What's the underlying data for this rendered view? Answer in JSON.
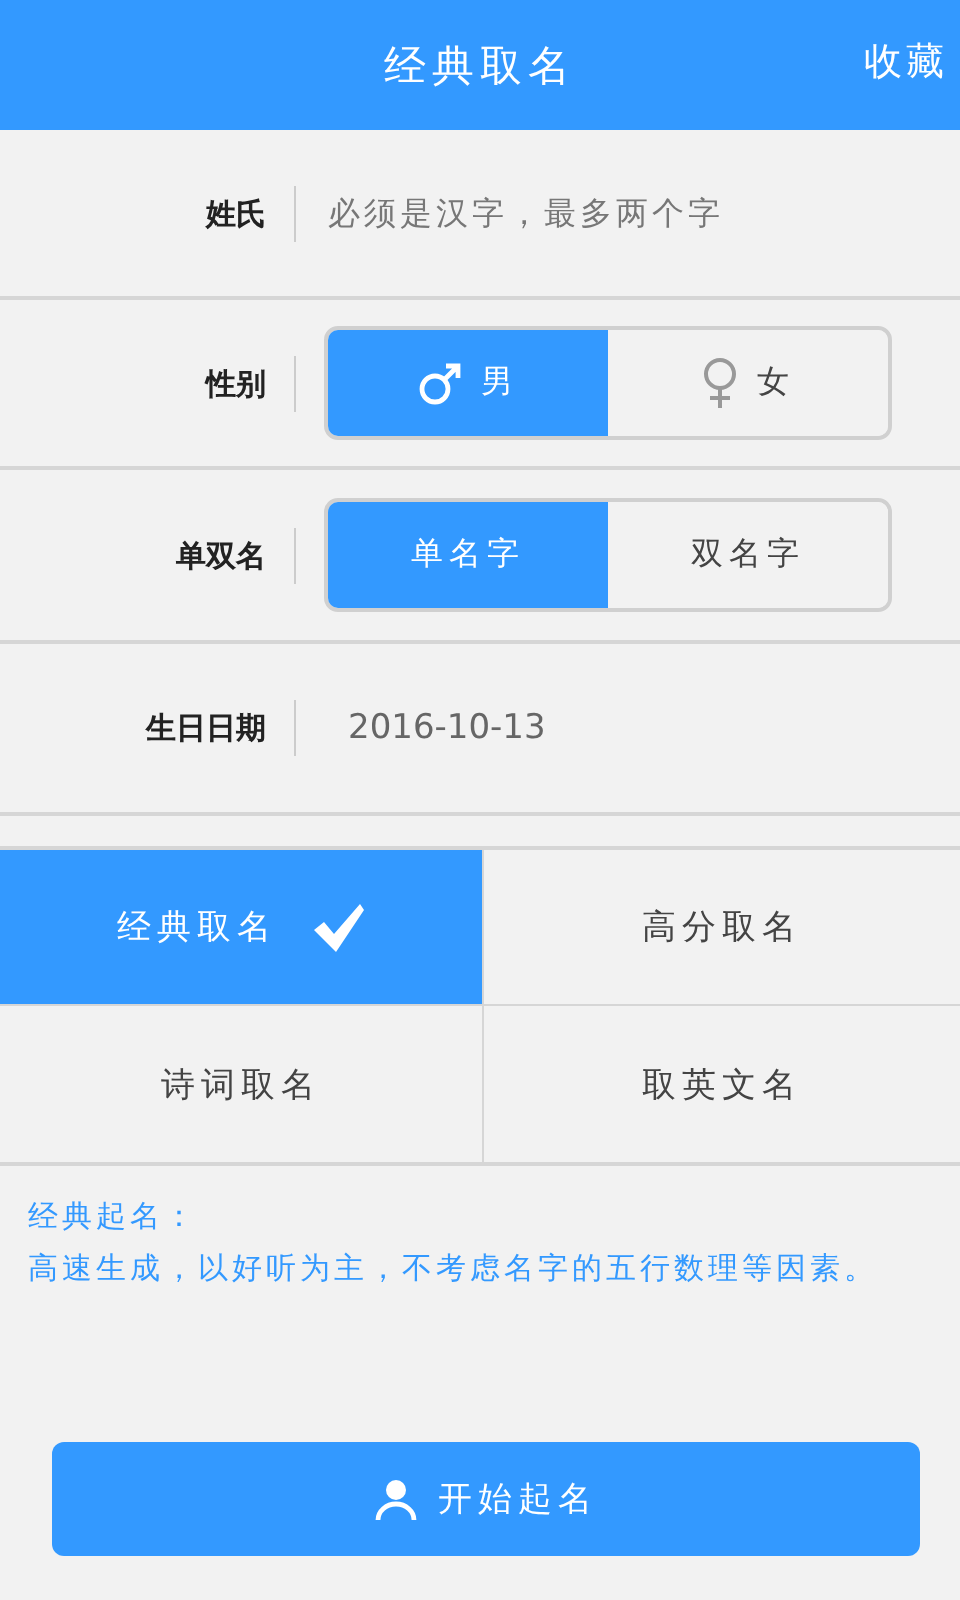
{
  "header": {
    "title": "经典取名",
    "action": "收藏"
  },
  "form": {
    "surname": {
      "label": "姓氏",
      "placeholder": "必须是汉字，最多两个字"
    },
    "gender": {
      "label": "性别",
      "options": [
        {
          "label": "男",
          "kind": "male",
          "selected": true
        },
        {
          "label": "女",
          "kind": "female",
          "selected": false
        }
      ]
    },
    "name_length": {
      "label": "单双名",
      "options": [
        {
          "label": "单名字",
          "selected": true
        },
        {
          "label": "双名字",
          "selected": false
        }
      ]
    },
    "birthday": {
      "label": "生日日期",
      "value": "2016-10-13"
    }
  },
  "modes": [
    {
      "label": "经典取名",
      "selected": true
    },
    {
      "label": "高分取名",
      "selected": false
    },
    {
      "label": "诗词取名",
      "selected": false
    },
    {
      "label": "取英文名",
      "selected": false
    }
  ],
  "description": {
    "title": "经典起名：",
    "text": "高速生成，以好听为主，不考虑名字的五行数理等因素。"
  },
  "start_button": {
    "label": "开始起名"
  }
}
